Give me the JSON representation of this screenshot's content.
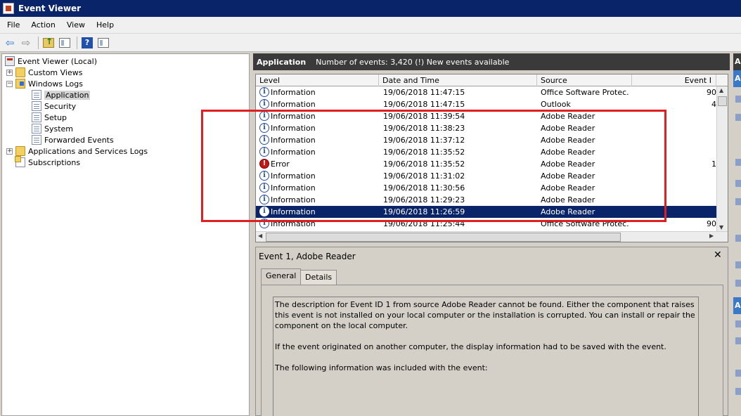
{
  "window": {
    "title": "Event Viewer"
  },
  "menu": [
    "File",
    "Action",
    "View",
    "Help"
  ],
  "toolbar": {
    "buttons": [
      "back-arrow",
      "forward-arrow",
      "up-folder",
      "show-hide-tree",
      "help",
      "show-hide-actions"
    ],
    "help_glyph": "?",
    "back_glyph": "⇦",
    "forward_glyph": "⇨"
  },
  "tree": {
    "root": "Event Viewer (Local)",
    "custom_views": "Custom Views",
    "windows_logs": "Windows Logs",
    "application": "Application",
    "security": "Security",
    "setup": "Setup",
    "system": "System",
    "forwarded_events": "Forwarded Events",
    "apps_services": "Applications and Services Logs",
    "subscriptions": "Subscriptions",
    "expand_glyph": "+",
    "collapse_glyph": "−"
  },
  "log_header": {
    "title": "Application",
    "info": "Number of events: 3,420 (!) New events available"
  },
  "columns": {
    "level": "Level",
    "date": "Date and Time",
    "source": "Source",
    "event_id": "Event I"
  },
  "events": [
    {
      "level": "Information",
      "icon": "i",
      "date": "19/06/2018 11:47:15",
      "source": "Office Software Protec...",
      "event_id": "90"
    },
    {
      "level": "Information",
      "icon": "i",
      "date": "19/06/2018 11:47:15",
      "source": "Outlook",
      "event_id": "4"
    },
    {
      "level": "Information",
      "icon": "i",
      "date": "19/06/2018 11:39:54",
      "source": "Adobe Reader",
      "event_id": ""
    },
    {
      "level": "Information",
      "icon": "i",
      "date": "19/06/2018 11:38:23",
      "source": "Adobe Reader",
      "event_id": ""
    },
    {
      "level": "Information",
      "icon": "i",
      "date": "19/06/2018 11:37:12",
      "source": "Adobe Reader",
      "event_id": ""
    },
    {
      "level": "Information",
      "icon": "i",
      "date": "19/06/2018 11:35:52",
      "source": "Adobe Reader",
      "event_id": ""
    },
    {
      "level": "Error",
      "icon": "!",
      "date": "19/06/2018 11:35:52",
      "source": "Adobe Reader",
      "event_id": "1"
    },
    {
      "level": "Information",
      "icon": "i",
      "date": "19/06/2018 11:31:02",
      "source": "Adobe Reader",
      "event_id": ""
    },
    {
      "level": "Information",
      "icon": "i",
      "date": "19/06/2018 11:30:56",
      "source": "Adobe Reader",
      "event_id": ""
    },
    {
      "level": "Information",
      "icon": "i",
      "date": "19/06/2018 11:29:23",
      "source": "Adobe Reader",
      "event_id": ""
    },
    {
      "level": "Information",
      "icon": "i",
      "date": "19/06/2018 11:26:59",
      "source": "Adobe Reader",
      "event_id": ""
    },
    {
      "level": "Information",
      "icon": "i",
      "date": "19/06/2018 11:25:44",
      "source": "Office Software Protec...",
      "event_id": "90"
    }
  ],
  "selected_event_index": 10,
  "details": {
    "title": "Event 1, Adobe Reader",
    "close_glyph": "✕",
    "tabs": [
      "General",
      "Details"
    ],
    "active_tab": "General",
    "paragraphs": [
      "The description for Event ID 1 from source Adobe Reader cannot be found. Either the component that raises this event is not installed on your local computer or the installation is corrupted. You can install or repair the component on the local computer.",
      "If the event originated on another computer, the display information had to be saved with the event.",
      "The following information was included with the event:"
    ]
  },
  "actions_pane": {
    "header_letter": "A"
  },
  "colors": {
    "title_bar": "#0a246a",
    "selection": "#0a246a",
    "highlight_box": "#e02020",
    "pane_header": "#3a3a3a",
    "error_icon": "#c41818",
    "info_icon": "#2850a0"
  }
}
